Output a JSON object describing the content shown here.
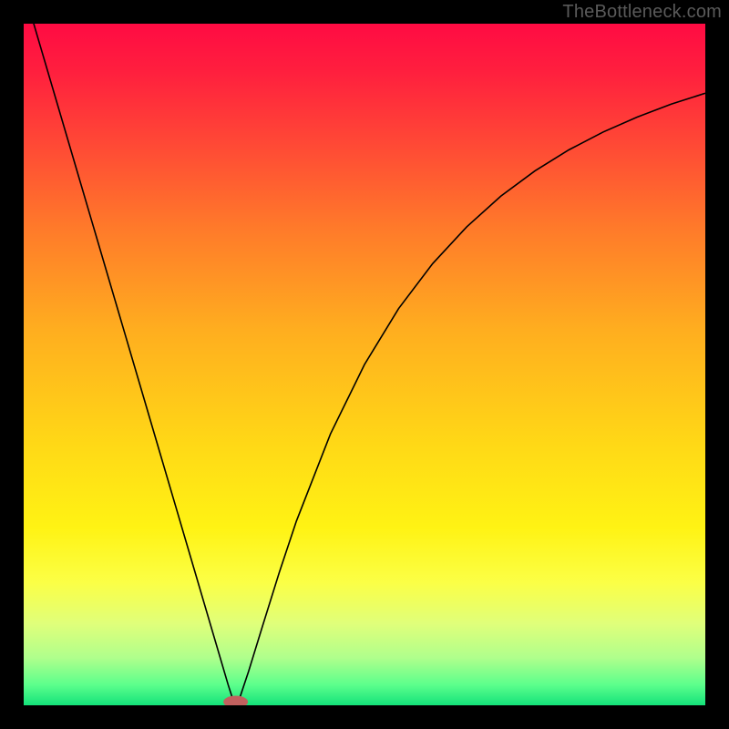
{
  "watermark": "TheBottleneck.com",
  "chart_data": {
    "type": "line",
    "title": "",
    "xlabel": "",
    "ylabel": "",
    "xlim": [
      0,
      100
    ],
    "ylim": [
      0,
      100
    ],
    "background_gradient": {
      "stops": [
        {
          "offset": 0.0,
          "color": "#ff0b43"
        },
        {
          "offset": 0.07,
          "color": "#ff1f3e"
        },
        {
          "offset": 0.18,
          "color": "#ff4a35"
        },
        {
          "offset": 0.3,
          "color": "#ff7a2a"
        },
        {
          "offset": 0.45,
          "color": "#ffae1f"
        },
        {
          "offset": 0.62,
          "color": "#ffd916"
        },
        {
          "offset": 0.74,
          "color": "#fff314"
        },
        {
          "offset": 0.82,
          "color": "#fbff46"
        },
        {
          "offset": 0.88,
          "color": "#e0ff7a"
        },
        {
          "offset": 0.93,
          "color": "#b0ff8c"
        },
        {
          "offset": 0.97,
          "color": "#5cff8c"
        },
        {
          "offset": 1.0,
          "color": "#14e27a"
        }
      ]
    },
    "series": [
      {
        "name": "curve",
        "color": "#000000",
        "x": [
          0.0,
          2.5,
          5.0,
          7.5,
          10.0,
          12.5,
          15.0,
          17.5,
          20.0,
          22.5,
          25.0,
          27.5,
          29.0,
          30.0,
          30.8,
          31.5,
          33.0,
          35.0,
          37.5,
          40.0,
          45.0,
          50.0,
          55.0,
          60.0,
          65.0,
          70.0,
          75.0,
          80.0,
          85.0,
          90.0,
          95.0,
          100.0
        ],
        "y": [
          105.0,
          96.5,
          88.0,
          79.5,
          71.0,
          62.5,
          54.0,
          45.5,
          37.0,
          28.5,
          20.0,
          11.5,
          6.4,
          3.0,
          0.5,
          0.5,
          5.0,
          11.5,
          19.5,
          27.0,
          39.8,
          50.0,
          58.2,
          64.8,
          70.2,
          74.7,
          78.4,
          81.5,
          84.1,
          86.3,
          88.2,
          89.8
        ]
      }
    ],
    "marker": {
      "name": "minimum-marker",
      "x": 31.1,
      "y": 0.5,
      "rx": 1.8,
      "ry": 0.9,
      "fill": "#c1605e"
    },
    "legend": null,
    "grid": false
  }
}
